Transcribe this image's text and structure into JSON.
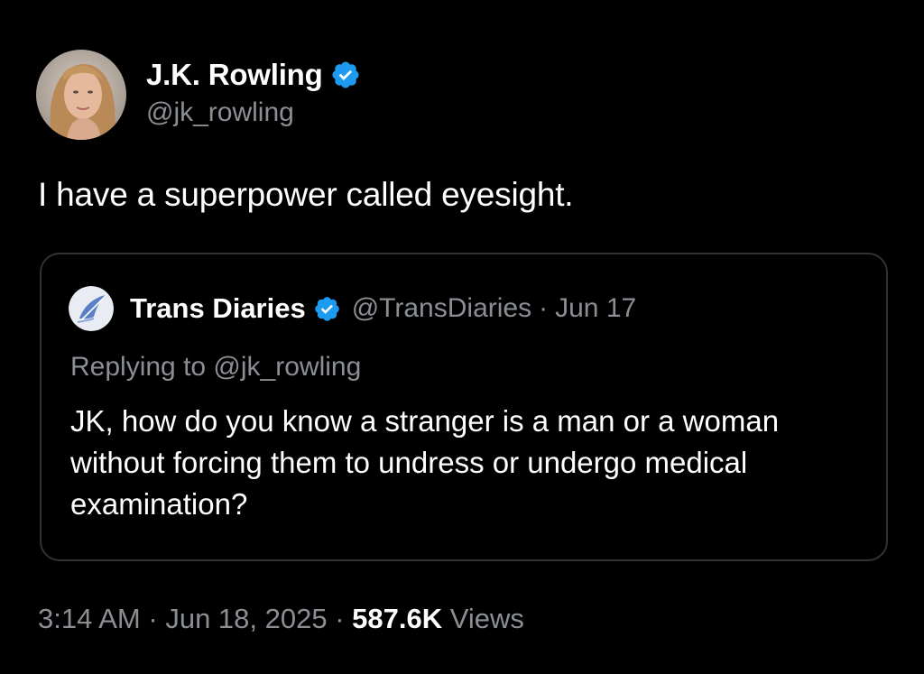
{
  "tweet": {
    "author": {
      "display_name": "J.K. Rowling",
      "handle": "@jk_rowling",
      "verified": true
    },
    "text": "I have a superpower called eyesight.",
    "quoted_tweet": {
      "author": {
        "display_name": "Trans Diaries",
        "handle": "@TransDiaries",
        "verified": true
      },
      "separator": "·",
      "date": "Jun 17",
      "replying_to": "Replying to @jk_rowling",
      "text": "JK, how do you know a stranger is a man or a woman without forcing them to undress or undergo medical examination?"
    },
    "footer": {
      "time": "3:14 AM",
      "separator": "·",
      "date": "Jun 18, 2025",
      "views_count": "587.6K",
      "views_label": "Views"
    }
  },
  "colors": {
    "background": "#000000",
    "primary_text": "#ffffff",
    "secondary_text": "#8b8f94",
    "verified_badge": "#1d9bf0",
    "border": "#2f3336"
  },
  "icons": {
    "verified": "verified-badge-icon"
  }
}
